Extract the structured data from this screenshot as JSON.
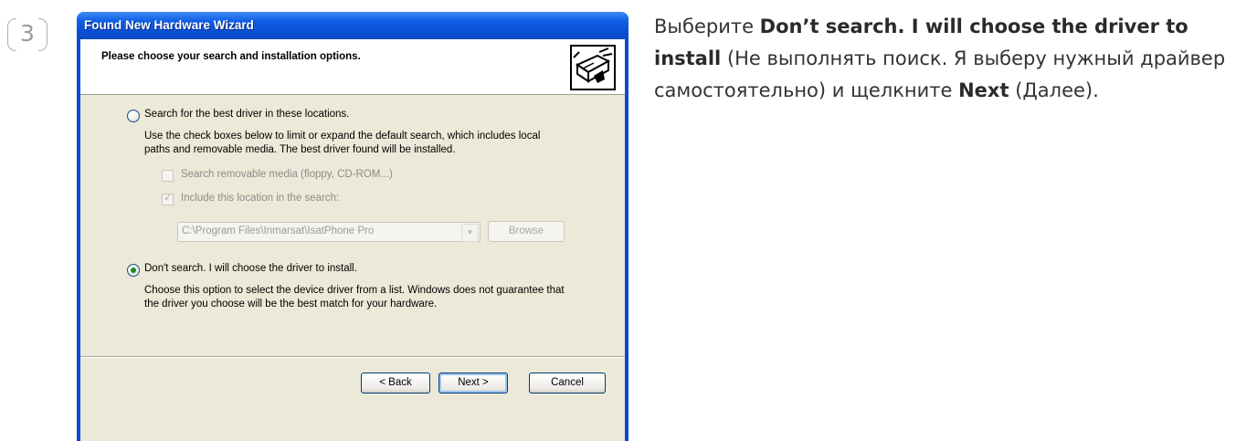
{
  "step": {
    "number": "3"
  },
  "dialog": {
    "title": "Found New Hardware Wizard",
    "header_title": "Please choose your search and installation options.",
    "header_icon": "hardware-install-icon",
    "option_search": {
      "label": "Search for the best driver in these locations.",
      "selected": false,
      "description_line1": "Use the check boxes below to limit or expand the default search, which includes local",
      "description_line2": "paths and removable media. The best driver found will be installed."
    },
    "check_removable": {
      "label": "Search removable media (floppy, CD-ROM...)",
      "checked": false
    },
    "check_location": {
      "label": "Include this location in the search:",
      "checked": true
    },
    "location_value": "C:\\Program Files\\Inmarsat\\IsatPhone Pro",
    "browse_label": "Browse",
    "option_dont_search": {
      "label": "Don't search. I will choose the driver to install.",
      "selected": true,
      "description_line1": "Choose this option to select the device driver from a list.  Windows does not guarantee that",
      "description_line2": "the driver you choose will be the best match for your hardware."
    },
    "back_label": "< Back",
    "next_label": "Next >",
    "cancel_label": "Cancel"
  },
  "instruction": {
    "part1": "Выберите ",
    "bold1": "Don’t search. I will choose the driver to install",
    "part2": " (Не выполнять поиск. Я выберу нужный драйвер самостоятельно) и щелкните ",
    "bold2": "Next",
    "part3": " (Далее)."
  },
  "colors": {
    "titlebar": "#0a4fd2",
    "dialog_face": "#ece9d8",
    "radio_dot": "#1e8a1e"
  }
}
